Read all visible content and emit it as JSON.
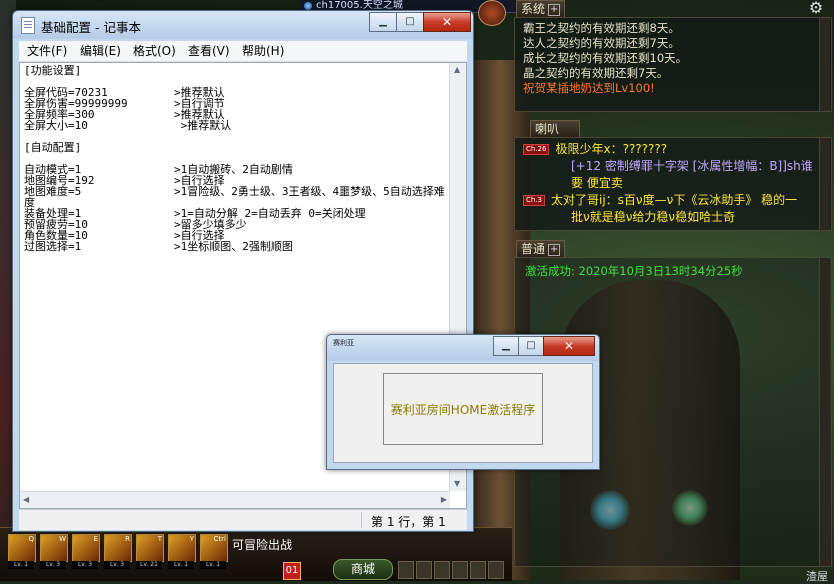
{
  "game": {
    "server_name": "ch17005.天空之城",
    "system_tab": "系统",
    "system_messages": [
      "霸王之契约的有效期还剩8天。",
      "达人之契约的有效期还剩7天。",
      "成长之契约的有效期还剩10天。",
      "晶之契约的有效期还剩7天。",
      "祝贺某插地奶达到Lv100!"
    ],
    "trumpet_tab": "喇叭",
    "trumpet_messages": [
      {
        "channel": "Ch.26",
        "text": "极限少年x：???????"
      },
      {
        "channel": "",
        "text": "[+12 密制缚罪十字架 [冰属性增幅：B]]sh谁"
      },
      {
        "channel": "",
        "text": "要 便宜卖"
      },
      {
        "channel": "Ch.3",
        "text": "太对了哥ij：s百ν度—ν下《云冰助手》 稳的一"
      },
      {
        "channel": "",
        "text": "批ν就是稳ν给力稳ν稳如哈士奇"
      }
    ],
    "normal_tab": "普通",
    "activation_message": "激活成功: 2020年10月3日13时34分25秒",
    "adventure_label": "可冒险出战",
    "mall_label": "商城",
    "notification_count": "01",
    "bottom_right_label": "渣屋",
    "skills": [
      {
        "key": "Q",
        "level": "Lv. 1"
      },
      {
        "key": "W",
        "level": "Lv. 3"
      },
      {
        "key": "E",
        "level": "Lv. 3"
      },
      {
        "key": "R",
        "level": "Lv. 3"
      },
      {
        "key": "T",
        "level": "Lv. 21"
      },
      {
        "key": "Y",
        "level": "Lv. 1"
      },
      {
        "key": "Ctrl",
        "level": "Lv. 1"
      }
    ]
  },
  "notepad": {
    "title": "基础配置 - 记事本",
    "menu": [
      "文件(F)",
      "编辑(E)",
      "格式(O)",
      "查看(V)",
      "帮助(H)"
    ],
    "content": "[功能设置]\n\n全屏代码=70231          >推荐默认\n全屏伤害=99999999       >自行调节\n全屏频率=300            >推荐默认\n全屏大小=10              >推荐默认\n\n[自动配置]\n\n自动模式=1              >1自动搬砖、2自动剧情\n地图编号=192            >自行选择\n地图难度=5              >1冒险级、2勇士级、3王者级、4噩梦级、5自动选择难\n度\n装备处理=1              >1=自动分解 2=自动丢弃 0=关闭处理\n预留疲劳=10             >留多少填多少\n角色数量=10             >自行选择\n过图选择=1              >1坐标顺图、2强制顺图",
    "status": "第 1 行，第 1",
    "btn_minimize": "▁",
    "btn_maximize": "□",
    "btn_close": "✕"
  },
  "dialog": {
    "title": "赛利亚",
    "message": "赛利亚房间HOME激活程序",
    "btn_minimize": "▁",
    "btn_maximize": "□",
    "btn_close": "✕"
  }
}
